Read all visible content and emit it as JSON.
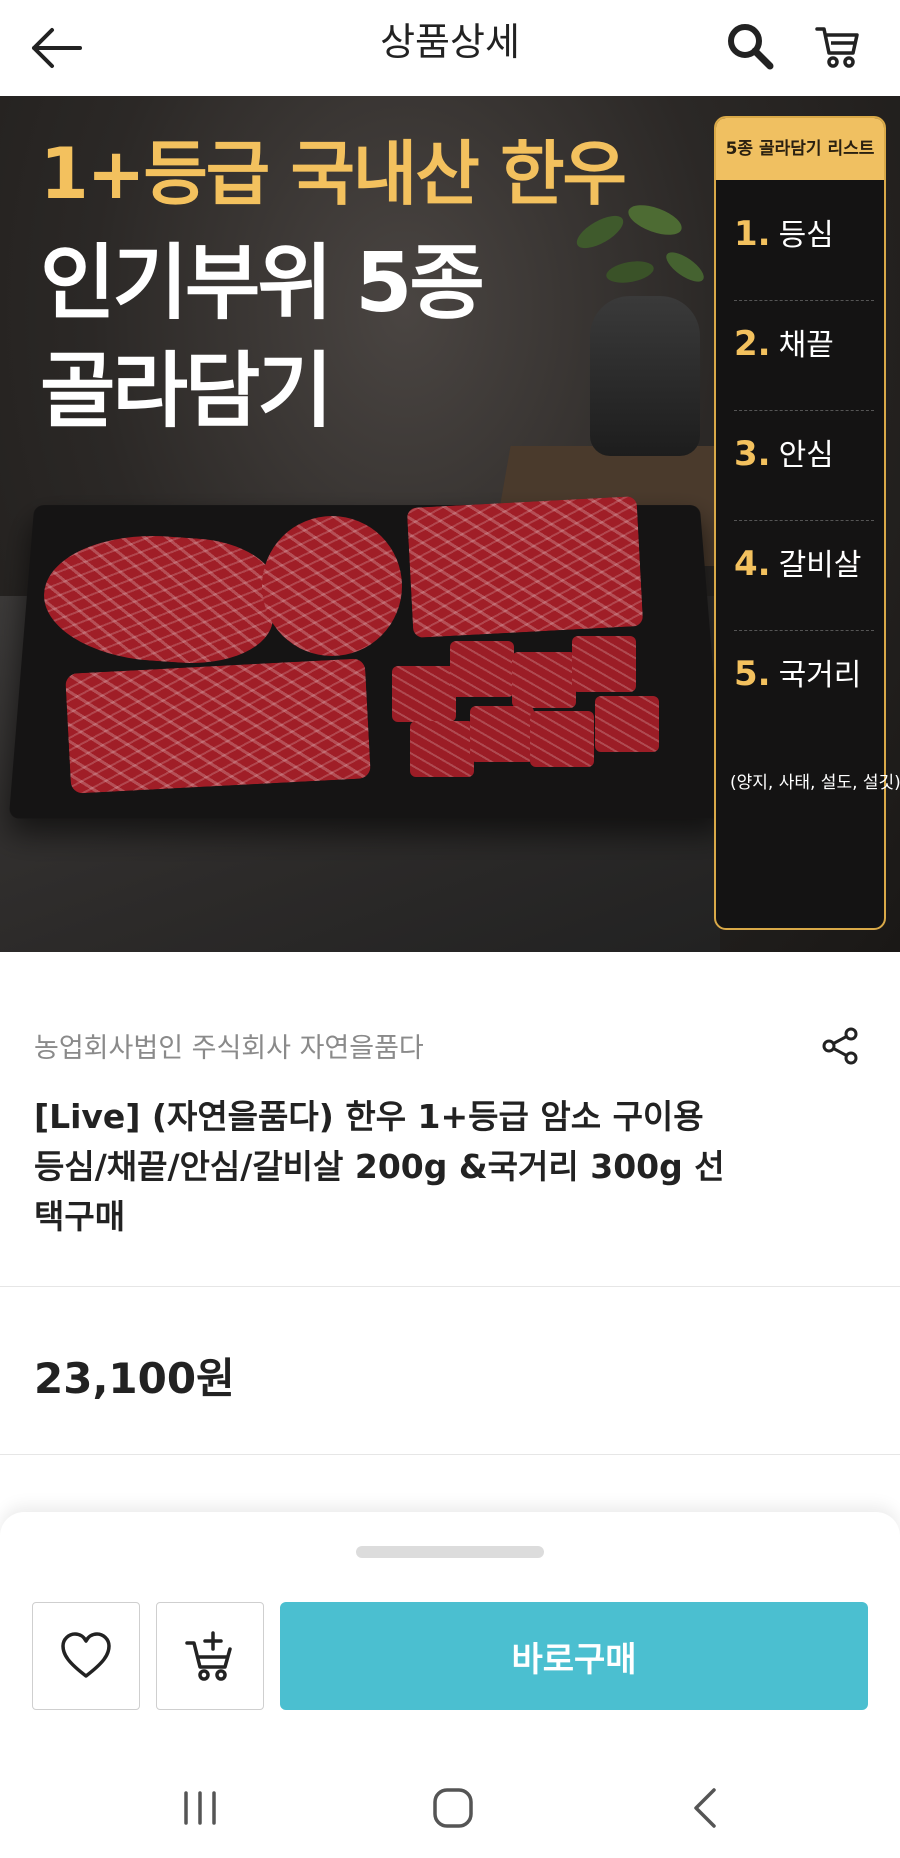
{
  "header": {
    "title": "상품상세"
  },
  "banner": {
    "grade_text": "1+등급 국내산 한우",
    "headline_line1": "인기부위 5종",
    "headline_line2": "골라담기",
    "list_title": "5종 골라담기 리스트",
    "list": [
      {
        "num": "1.",
        "label": "등심"
      },
      {
        "num": "2.",
        "label": "채끝"
      },
      {
        "num": "3.",
        "label": "안심"
      },
      {
        "num": "4.",
        "label": "갈비살"
      },
      {
        "num": "5.",
        "label": "국거리"
      }
    ],
    "list_note": "(양지, 사태, 설도, 설깃)"
  },
  "product": {
    "seller": "농업회사법인 주식회사 자연을품다",
    "title": "[Live] (자연을품다) 한우 1+등급 암소 구이용 등심/채끝/안심/갈비살 200g &국거리 300g 선택구매",
    "price": "23,100원"
  },
  "sheet": {
    "buy_label": "바로구매"
  },
  "icons": {
    "back": "back-arrow-icon",
    "search": "search-icon",
    "cart": "cart-icon",
    "share": "share-icon",
    "wish": "heart-icon",
    "add_cart": "cart-plus-icon"
  },
  "colors": {
    "accent": "#4bbfd0",
    "gold": "#f3c15e"
  }
}
